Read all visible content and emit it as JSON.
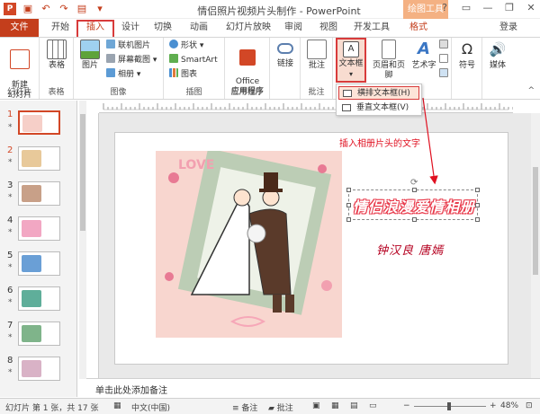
{
  "window": {
    "title": "情侣照片视频片头制作 - PowerPoint",
    "drawing_tools": "绘图工具",
    "login": "登录",
    "help": "?",
    "minimize": "—",
    "restore": "❐",
    "close": "✕"
  },
  "tabs": [
    "文件",
    "开始",
    "插入",
    "设计",
    "切换",
    "动画",
    "幻灯片放映",
    "审阅",
    "视图",
    "开发工具",
    "格式"
  ],
  "ribbon": {
    "new_slide": "新建\n幻灯片",
    "slides_group": "幻灯片",
    "table": "表格",
    "tables_group": "表格",
    "picture": "图片",
    "online_picture": "联机图片",
    "screenshot": "屏幕截图",
    "album": "相册",
    "images_group": "图像",
    "shapes": "形状",
    "smartart": "SmartArt",
    "chart": "图表",
    "illustrations_group": "插图",
    "office_apps": "Office\n应用程序",
    "apps_group": "应用程序",
    "link": "链接",
    "comment": "批注",
    "comments_group": "批注",
    "textbox": "文本框",
    "header_footer": "页眉和页脚",
    "wordart": "艺术字",
    "symbol": "符号",
    "media": "媒体"
  },
  "dropdown": {
    "horizontal": "横排文本框(H)",
    "vertical": "垂直文本框(V)"
  },
  "thumbnails": [
    "1",
    "2",
    "3",
    "4",
    "5",
    "6",
    "7",
    "8"
  ],
  "thumb_star": "*",
  "slide": {
    "title_text": "情侣浪漫爱情相册",
    "authors": "钟汉良  唐嫣",
    "annotation": "插入相册片头的文字"
  },
  "notes_placeholder": "单击此处添加备注",
  "status": {
    "slide_info": "幻灯片 第 1 张，共 17 张",
    "language": "中文(中国)",
    "notes": "备注",
    "comments": "批注",
    "zoom": "48%"
  },
  "colors": {
    "accent": "#c43e1c",
    "highlight": "#d83b3b",
    "title_outline": "#e83a4b",
    "authors": "#b50020"
  }
}
